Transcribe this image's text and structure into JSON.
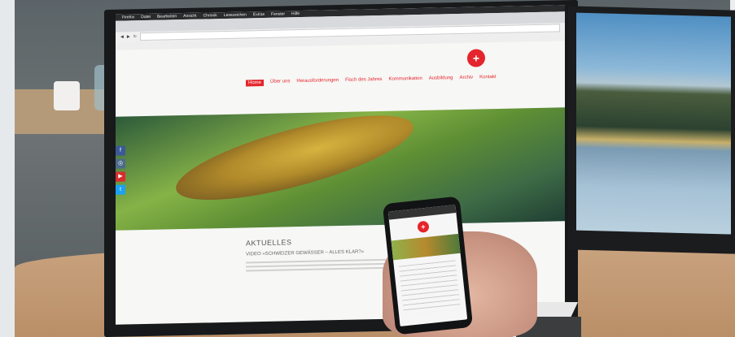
{
  "browser": {
    "app_menu": [
      "Firefox",
      "Datei",
      "Bearbeiten",
      "Ansicht",
      "Chronik",
      "Lesezeichen",
      "Extras",
      "Fenster",
      "Hilfe"
    ]
  },
  "website": {
    "logo_symbol": "+",
    "nav_items": [
      "Home",
      "Über uns",
      "Herausforderungen",
      "Fisch des Jahres",
      "Kommunikation",
      "Ausbildung",
      "Archiv",
      "Kontakt"
    ],
    "section_heading": "AKTUELLES",
    "article_title": "VIDEO «SCHWEIZER GEWÄSSER – ALLES KLAR?»",
    "social_icons": [
      "f",
      "◎",
      "▶",
      "t"
    ]
  },
  "phone": {
    "logo_symbol": "+"
  },
  "colors": {
    "brand_red": "#e4252b"
  }
}
